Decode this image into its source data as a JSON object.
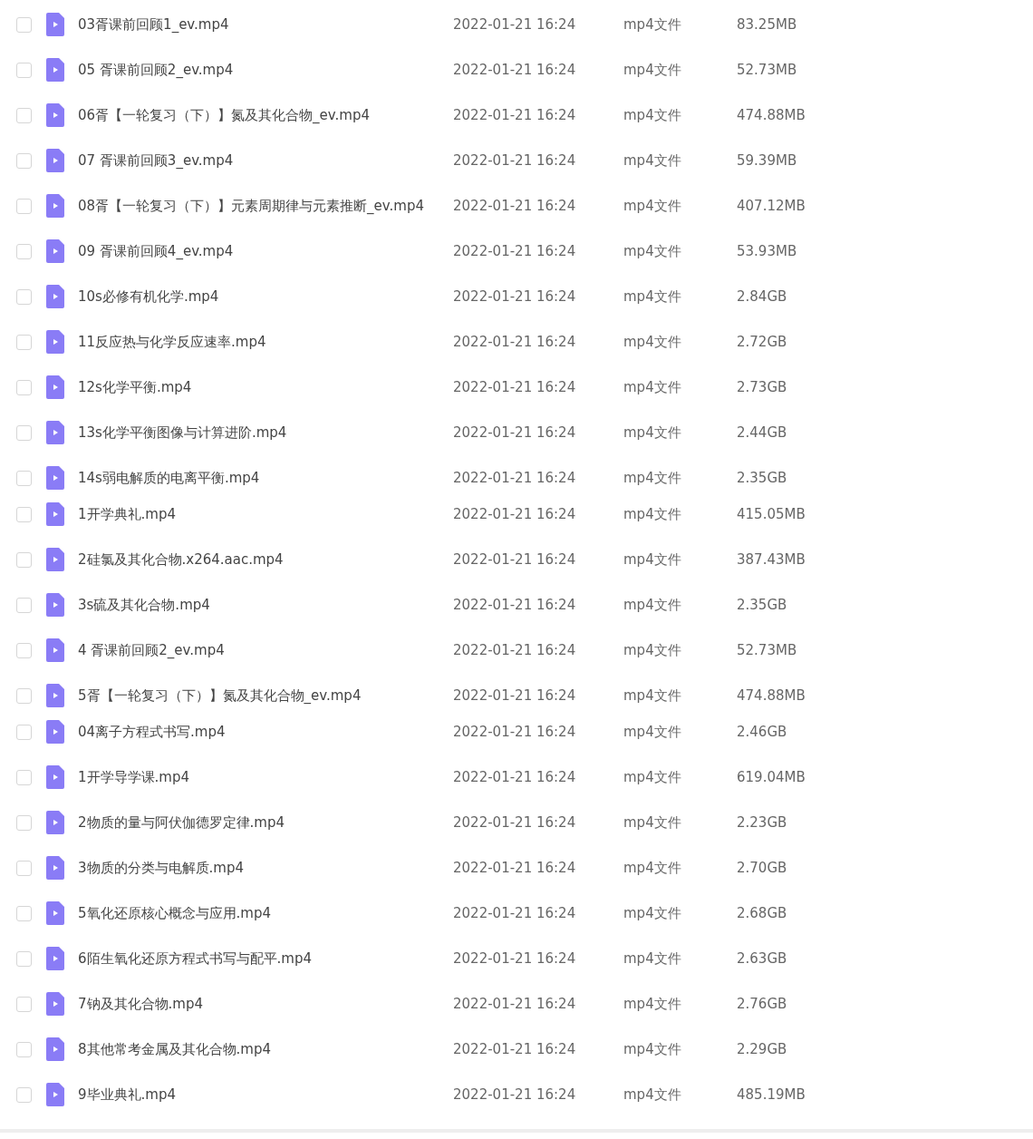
{
  "groups": [
    {
      "files": [
        {
          "name": "03胥课前回顾1_ev.mp4",
          "date": "2022-01-21 16:24",
          "type": "mp4文件",
          "size": "83.25MB",
          "checked": false
        },
        {
          "name": "05 胥课前回顾2_ev.mp4",
          "date": "2022-01-21 16:24",
          "type": "mp4文件",
          "size": "52.73MB",
          "checked": false
        },
        {
          "name": "06胥【一轮复习（下）】氮及其化合物_ev.mp4",
          "date": "2022-01-21 16:24",
          "type": "mp4文件",
          "size": "474.88MB",
          "checked": false
        },
        {
          "name": "07 胥课前回顾3_ev.mp4",
          "date": "2022-01-21 16:24",
          "type": "mp4文件",
          "size": "59.39MB",
          "checked": false
        },
        {
          "name": "08胥【一轮复习（下）】元素周期律与元素推断_ev.mp4",
          "date": "2022-01-21 16:24",
          "type": "mp4文件",
          "size": "407.12MB",
          "checked": false
        },
        {
          "name": "09 胥课前回顾4_ev.mp4",
          "date": "2022-01-21 16:24",
          "type": "mp4文件",
          "size": "53.93MB",
          "checked": false
        },
        {
          "name": "10s必修有机化学.mp4",
          "date": "2022-01-21 16:24",
          "type": "mp4文件",
          "size": "2.84GB",
          "checked": false
        },
        {
          "name": "11反应热与化学反应速率.mp4",
          "date": "2022-01-21 16:24",
          "type": "mp4文件",
          "size": "2.72GB",
          "checked": false
        },
        {
          "name": "12s化学平衡.mp4",
          "date": "2022-01-21 16:24",
          "type": "mp4文件",
          "size": "2.73GB",
          "checked": false
        },
        {
          "name": "13s化学平衡图像与计算进阶.mp4",
          "date": "2022-01-21 16:24",
          "type": "mp4文件",
          "size": "2.44GB",
          "checked": false
        },
        {
          "name": "14s弱电解质的电离平衡.mp4",
          "date": "2022-01-21 16:24",
          "type": "mp4文件",
          "size": "2.35GB",
          "checked": false
        }
      ]
    },
    {
      "files": [
        {
          "name": "1开学典礼.mp4",
          "date": "2022-01-21 16:24",
          "type": "mp4文件",
          "size": "415.05MB",
          "checked": false
        },
        {
          "name": "2硅氯及其化合物.x264.aac.mp4",
          "date": "2022-01-21 16:24",
          "type": "mp4文件",
          "size": "387.43MB",
          "checked": false
        },
        {
          "name": "3s硫及其化合物.mp4",
          "date": "2022-01-21 16:24",
          "type": "mp4文件",
          "size": "2.35GB",
          "checked": false
        },
        {
          "name": "4 胥课前回顾2_ev.mp4",
          "date": "2022-01-21 16:24",
          "type": "mp4文件",
          "size": "52.73MB",
          "checked": false
        },
        {
          "name": "5胥【一轮复习（下）】氮及其化合物_ev.mp4",
          "date": "2022-01-21 16:24",
          "type": "mp4文件",
          "size": "474.88MB",
          "checked": false
        }
      ]
    },
    {
      "files": [
        {
          "name": "04离子方程式书写.mp4",
          "date": "2022-01-21 16:24",
          "type": "mp4文件",
          "size": "2.46GB",
          "checked": false
        },
        {
          "name": "1开学导学课.mp4",
          "date": "2022-01-21 16:24",
          "type": "mp4文件",
          "size": "619.04MB",
          "checked": false
        },
        {
          "name": "2物质的量与阿伏伽德罗定律.mp4",
          "date": "2022-01-21 16:24",
          "type": "mp4文件",
          "size": "2.23GB",
          "checked": false
        },
        {
          "name": "3物质的分类与电解质.mp4",
          "date": "2022-01-21 16:24",
          "type": "mp4文件",
          "size": "2.70GB",
          "checked": false
        },
        {
          "name": "5氧化还原核心概念与应用.mp4",
          "date": "2022-01-21 16:24",
          "type": "mp4文件",
          "size": "2.68GB",
          "checked": false
        },
        {
          "name": "6陌生氧化还原方程式书写与配平.mp4",
          "date": "2022-01-21 16:24",
          "type": "mp4文件",
          "size": "2.63GB",
          "checked": false
        },
        {
          "name": "7钠及其化合物.mp4",
          "date": "2022-01-21 16:24",
          "type": "mp4文件",
          "size": "2.76GB",
          "checked": false
        },
        {
          "name": "8其他常考金属及其化合物.mp4",
          "date": "2022-01-21 16:24",
          "type": "mp4文件",
          "size": "2.29GB",
          "checked": false
        },
        {
          "name": "9毕业典礼.mp4",
          "date": "2022-01-21 16:24",
          "type": "mp4文件",
          "size": "485.19MB",
          "checked": false
        }
      ]
    }
  ]
}
